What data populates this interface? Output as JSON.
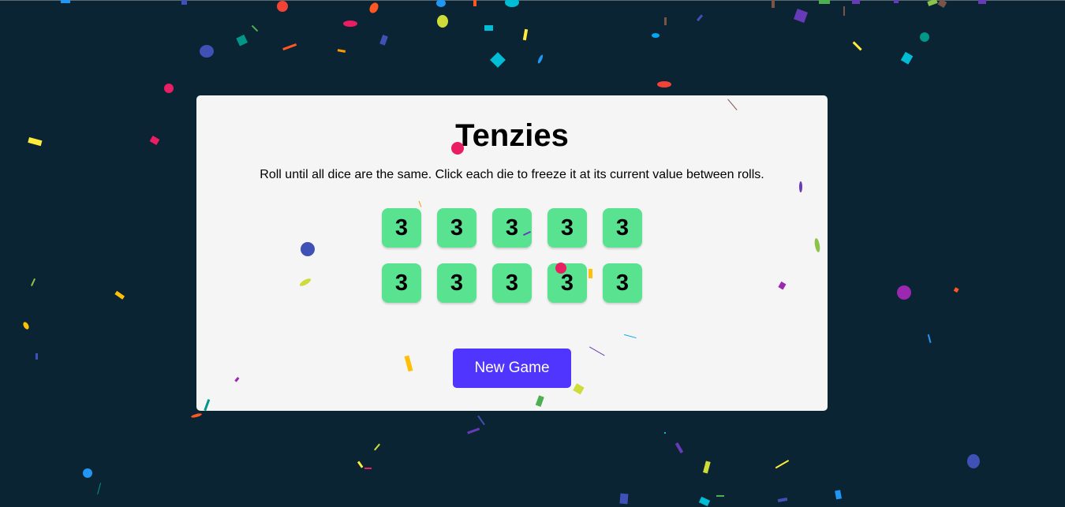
{
  "game": {
    "title": "Tenzies",
    "instructions": "Roll until all dice are the same. Click each die to freeze it at its current value between rolls.",
    "dice": [
      {
        "value": "3",
        "held": true
      },
      {
        "value": "3",
        "held": true
      },
      {
        "value": "3",
        "held": true
      },
      {
        "value": "3",
        "held": true
      },
      {
        "value": "3",
        "held": true
      },
      {
        "value": "3",
        "held": true
      },
      {
        "value": "3",
        "held": true
      },
      {
        "value": "3",
        "held": true
      },
      {
        "value": "3",
        "held": true
      },
      {
        "value": "3",
        "held": true
      }
    ],
    "button_label": "New Game"
  },
  "colors": {
    "background": "#0b2434",
    "card": "#f5f5f5",
    "held_die": "#59e391",
    "button": "#5035ff",
    "confetti": [
      "#f44336",
      "#e91e63",
      "#9c27b0",
      "#673ab7",
      "#3f51b5",
      "#2196f3",
      "#03a9f4",
      "#00bcd4",
      "#009688",
      "#4caf50",
      "#8bc34a",
      "#cddc39",
      "#ffeb3b",
      "#ffc107",
      "#ff9800",
      "#ff5722",
      "#795548"
    ]
  }
}
